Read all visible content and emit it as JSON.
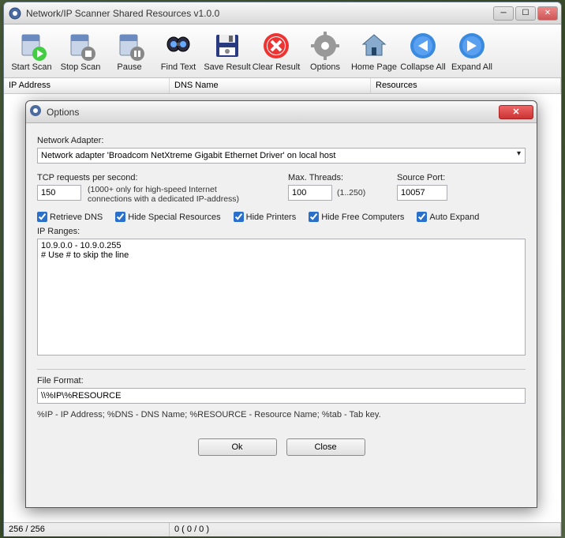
{
  "main": {
    "title": "Network/IP Scanner Shared Resources v1.0.0",
    "toolbar": [
      {
        "label": "Start Scan",
        "icon": "start-scan"
      },
      {
        "label": "Stop Scan",
        "icon": "stop-scan"
      },
      {
        "label": "Pause",
        "icon": "pause"
      },
      {
        "label": "Find Text",
        "icon": "find"
      },
      {
        "label": "Save Result",
        "icon": "save"
      },
      {
        "label": "Clear Result",
        "icon": "clear"
      },
      {
        "label": "Options",
        "icon": "options"
      },
      {
        "label": "Home Page",
        "icon": "home"
      },
      {
        "label": "Collapse All",
        "icon": "collapse"
      },
      {
        "label": "Expand All",
        "icon": "expand"
      }
    ],
    "columns": [
      "IP Address",
      "DNS Name",
      "Resources"
    ],
    "status": {
      "left": "256 / 256",
      "right": "0 ( 0 / 0 )"
    }
  },
  "dialog": {
    "title": "Options",
    "adapter_label": "Network Adapter:",
    "adapter_value": "Network adapter 'Broadcom NetXtreme Gigabit Ethernet Driver' on local host",
    "tcp_label": "TCP requests per second:",
    "tcp_value": "150",
    "tcp_hint": "(1000+ only for high-speed Internet connections with a dedicated IP-address)",
    "threads_label": "Max. Threads:",
    "threads_value": "100",
    "threads_hint": "(1..250)",
    "port_label": "Source Port:",
    "port_value": "10057",
    "checks": {
      "dns": "Retrieve DNS",
      "special": "Hide Special Resources",
      "printers": "Hide Printers",
      "free": "Hide Free Computers",
      "auto": "Auto Expand"
    },
    "ranges_label": "IP Ranges:",
    "ranges_value": "10.9.0.0 - 10.9.0.255\n# Use # to skip the line",
    "format_label": "File Format:",
    "format_value": "\\\\%IP\\%RESOURCE",
    "format_hint": "%IP - IP Address;  %DNS - DNS Name;  %RESOURCE - Resource Name;  %tab - Tab key.",
    "ok": "Ok",
    "close": "Close"
  }
}
